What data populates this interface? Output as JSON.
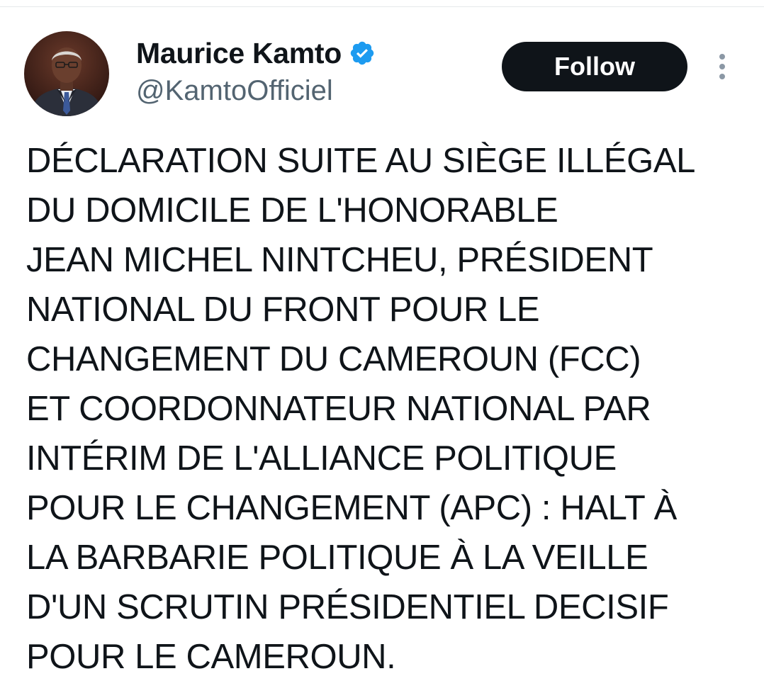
{
  "author": {
    "display_name": "Maurice Kamto",
    "handle": "@KamtoOfficiel",
    "verified": true,
    "avatar": "profile-photo"
  },
  "actions": {
    "follow_label": "Follow",
    "more_icon": "more-vertical-icon"
  },
  "tweet": {
    "lines": [
      "DÉCLARATION SUITE AU SIÈGE ILLÉGAL",
      "DU DOMICILE DE L'HONORABLE",
      "JEAN MICHEL NINTCHEU, PRÉSIDENT",
      "NATIONAL DU FRONT POUR LE",
      "CHANGEMENT DU CAMEROUN (FCC)",
      "ET COORDONNATEUR NATIONAL PAR",
      "INTÉRIM DE L'ALLIANCE POLITIQUE",
      "POUR LE CHANGEMENT (APC) : HALT À",
      "LA BARBARIE POLITIQUE À LA VEILLE",
      "D'UN SCRUTIN PRÉSIDENTIEL DECISIF",
      "POUR LE CAMEROUN."
    ]
  },
  "colors": {
    "text_primary": "#0f1419",
    "text_secondary": "#536471",
    "verified_blue": "#1d9bf0",
    "follow_bg": "#0f1419",
    "follow_text": "#ffffff"
  }
}
